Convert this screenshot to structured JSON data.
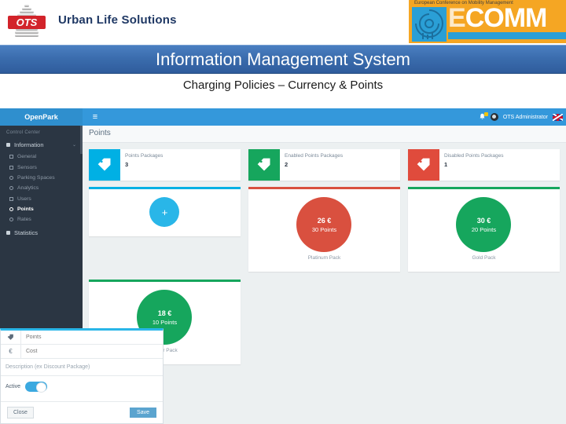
{
  "slide": {
    "company_name": "Urban Life Solutions",
    "logo_text": "OTS",
    "conference_tagline": "European Conference on Mobility Management",
    "conference_name_first": "E",
    "conference_name_rest": "COMM",
    "banner_title": "Information Management System",
    "subtitle": "Charging Policies – Currency & Points"
  },
  "app": {
    "navbar": {
      "brand": "OpenPark",
      "menu_icon": "≡",
      "bell_icon": "🔔",
      "user_name": "OTS Administrator",
      "language_flag": "en-GB"
    },
    "sidebar": {
      "header": "Control Center",
      "main_item": {
        "label": "Information",
        "icon": "briefcase-icon",
        "caret": "⌄"
      },
      "items": [
        {
          "label": "General",
          "icon": "square-icon",
          "active": false
        },
        {
          "label": "Sensors",
          "icon": "square-icon",
          "active": false
        },
        {
          "label": "Parking Spaces",
          "icon": "circle-icon",
          "active": false
        },
        {
          "label": "Analytics",
          "icon": "circle-icon",
          "active": false
        },
        {
          "label": "Users",
          "icon": "square-icon",
          "active": false
        },
        {
          "label": "Points",
          "icon": "circle-icon",
          "active": true
        },
        {
          "label": "Rates",
          "icon": "circle-icon",
          "active": false
        }
      ],
      "footer_item": {
        "label": "Statistics",
        "icon": "chart-icon"
      }
    },
    "page": {
      "title": "Points"
    },
    "stats": [
      {
        "label": "Points Packages",
        "value": "3",
        "color": "#00b0e4",
        "icon": "tags-icon"
      },
      {
        "label": "Enabled Points Packages",
        "value": "2",
        "color": "#16a65d",
        "icon": "tags-icon"
      },
      {
        "label": "Disabled Points Packages",
        "value": "1",
        "color": "#e04b3c",
        "icon": "tags-icon"
      }
    ],
    "packages": [
      {
        "kind": "add",
        "accent": "#00b0e4",
        "add_icon": "+"
      },
      {
        "kind": "package",
        "accent": "#d9503f",
        "cost": "26 €",
        "points": "30 Points",
        "name": "Platinum Pack",
        "circle_color": "#d9503f"
      },
      {
        "kind": "package",
        "accent": "#16a65d",
        "cost": "30 €",
        "points": "20 Points",
        "name": "Gold Pack",
        "circle_color": "#16a65d"
      },
      {
        "kind": "package",
        "accent": "#16a65d",
        "cost": "18 €",
        "points": "10 Points",
        "name": "Silver Pack",
        "circle_color": "#16a65d"
      }
    ],
    "form": {
      "points_icon": "tag-icon",
      "points_placeholder": "Points",
      "cost_icon": "€",
      "cost_placeholder": "Cost",
      "description_placeholder": "Description (ex Discount Package)",
      "active_label": "Active",
      "active_on": true,
      "close_label": "Close",
      "save_label": "Save"
    }
  }
}
